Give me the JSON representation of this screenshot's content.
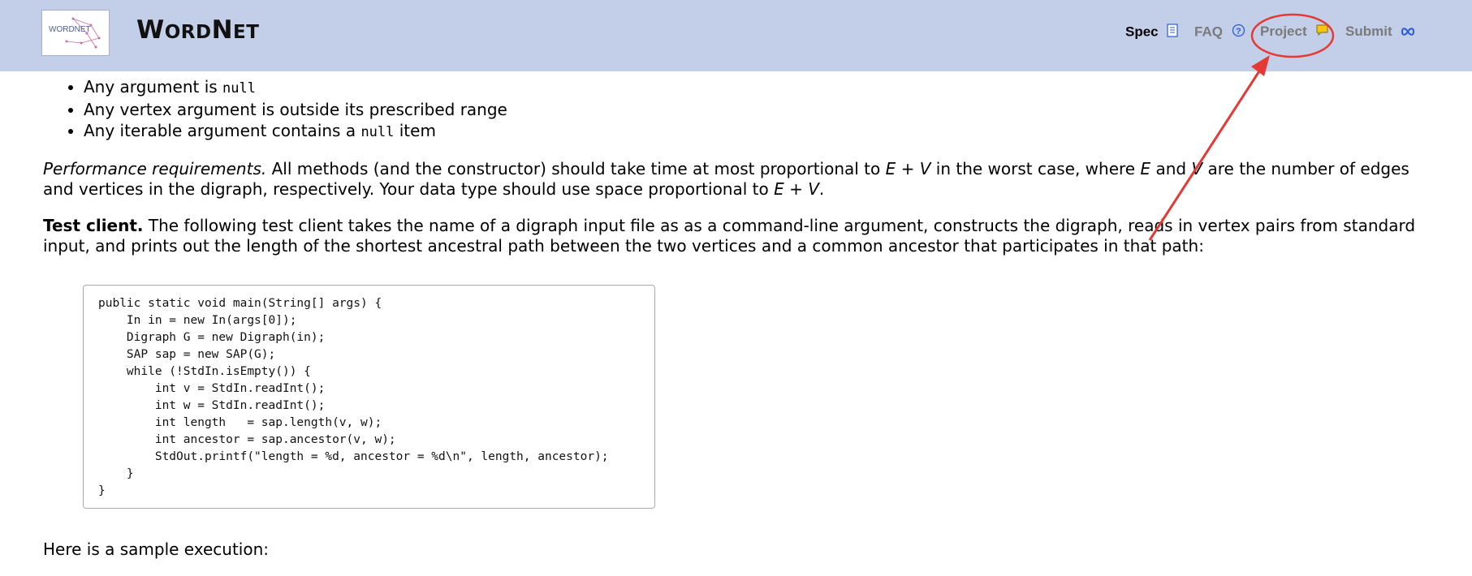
{
  "header": {
    "logo_text": "WORDNET",
    "title_first": "W",
    "title_rest1": "ORD",
    "title_mid": "N",
    "title_rest2": "ET",
    "nav": {
      "spec": "Spec",
      "faq": "FAQ",
      "project": "Project",
      "submit": "Submit"
    },
    "nav_icons": [
      "document-icon",
      "question-circle-icon",
      "chat-bubble-icon",
      "infinity-icon"
    ]
  },
  "bullets": {
    "b1_pre": "Any argument is ",
    "b1_code": "null",
    "b2": "Any vertex argument is outside its prescribed range",
    "b3_pre": "Any iterable argument contains a ",
    "b3_code": "null",
    "b3_post": " item"
  },
  "performance": {
    "label": "Performance requirements.",
    "text1": "  All methods (and the constructor) should take time at most proportional to ",
    "expr1": "E + V",
    "text2": " in the worst case, where ",
    "var_e": "E",
    "text3": " and ",
    "var_v": "V",
    "text4": " are the number of edges and vertices in the digraph, respectively. Your data type should use space proportional to ",
    "expr2": "E + V",
    "text5": "."
  },
  "test_client": {
    "label": "Test client.",
    "text": " The following test client takes the name of a digraph input file as as a command-line argument, constructs the digraph, reads in vertex pairs from standard input, and prints out the length of the shortest ancestral path between the two vertices and a common ancestor that participates in that path:"
  },
  "code_lines": [
    "public static void main(String[] args) {",
    "    In in = new In(args[0]);",
    "    Digraph G = new Digraph(in);",
    "    SAP sap = new SAP(G);",
    "    while (!StdIn.isEmpty()) {",
    "        int v = StdIn.readInt();",
    "        int w = StdIn.readInt();",
    "        int length   = sap.length(v, w);",
    "        int ancestor = sap.ancestor(v, w);",
    "        StdOut.printf(\"length = %d, ancestor = %d\\n\", length, ancestor);",
    "    }",
    "}"
  ],
  "sample": "Here is a sample execution:",
  "colors": {
    "header_bg": "#c3cfe8",
    "annotation_red": "#e53935",
    "nav_active": "#000000",
    "nav_inactive": "#7a7a7a",
    "link_blue": "#2a5bd7"
  }
}
